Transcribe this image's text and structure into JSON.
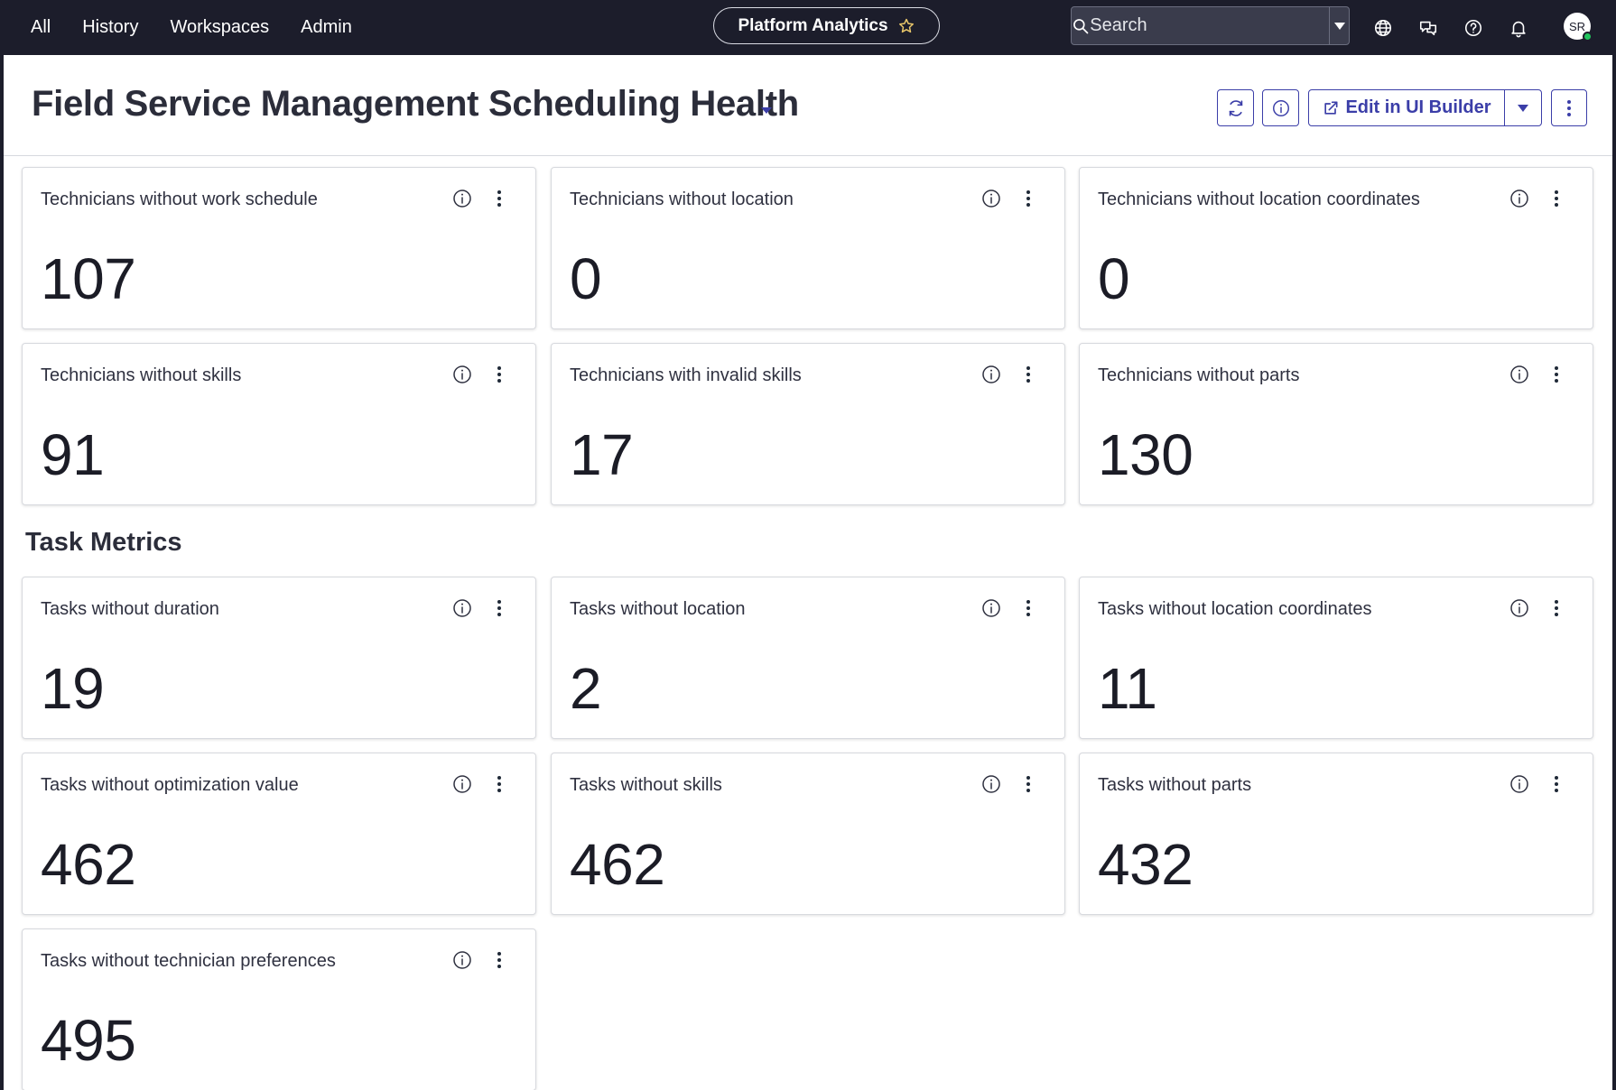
{
  "nav": {
    "links": [
      "All",
      "History",
      "Workspaces",
      "Admin"
    ],
    "app_pill": "Platform Analytics",
    "search_placeholder": "Search",
    "avatar_initials": "SR"
  },
  "header": {
    "title": "Field Service Management Scheduling Health",
    "edit_button": "Edit in UI Builder"
  },
  "section": {
    "task_metrics_title": "Task Metrics"
  },
  "technician_cards": [
    {
      "title": "Technicians without work schedule",
      "value": "107"
    },
    {
      "title": "Technicians without location",
      "value": "0"
    },
    {
      "title": "Technicians without location coordinates",
      "value": "0"
    },
    {
      "title": "Technicians without skills",
      "value": "91"
    },
    {
      "title": "Technicians with invalid skills",
      "value": "17"
    },
    {
      "title": "Technicians without parts",
      "value": "130"
    }
  ],
  "task_cards": [
    {
      "title": "Tasks without duration",
      "value": "19"
    },
    {
      "title": "Tasks without location",
      "value": "2"
    },
    {
      "title": "Tasks without location coordinates",
      "value": "11"
    },
    {
      "title": "Tasks without optimization value",
      "value": "462"
    },
    {
      "title": "Tasks without skills",
      "value": "462"
    },
    {
      "title": "Tasks without parts",
      "value": "432"
    },
    {
      "title": "Tasks without technician preferences",
      "value": "495"
    }
  ],
  "colors": {
    "nav_bg": "#1c1d2b",
    "accent": "#3b3ea8",
    "star": "#e8c66a",
    "presence": "#22c55e"
  }
}
